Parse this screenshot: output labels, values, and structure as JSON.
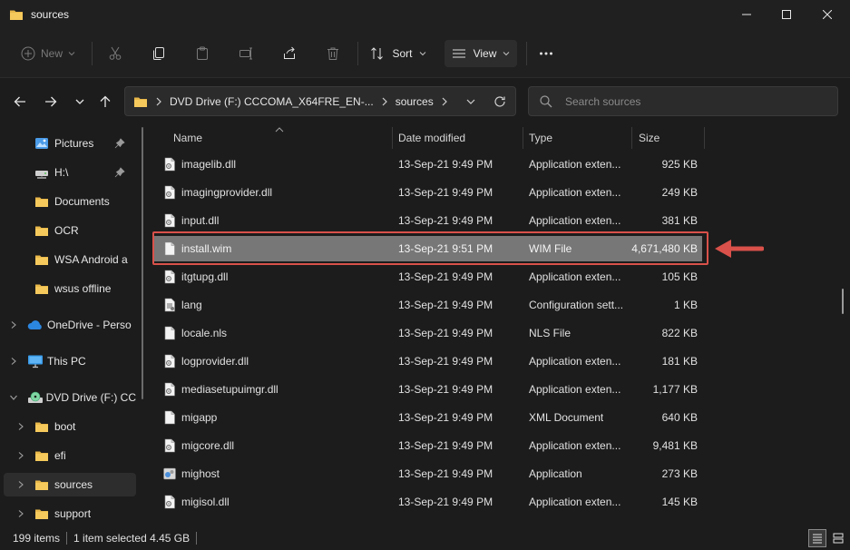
{
  "window": {
    "title": "sources",
    "controls": [
      "minimize-icon",
      "maximize-icon",
      "close-icon"
    ]
  },
  "toolbar": {
    "new_label": "New",
    "sort_label": "Sort",
    "view_label": "View",
    "icons": [
      "cut-icon",
      "copy-icon",
      "paste-icon",
      "rename-icon",
      "share-icon",
      "delete-icon",
      "more-icon"
    ]
  },
  "address": {
    "drive": "DVD Drive (F:) CCCOMA_X64FRE_EN-...",
    "folder": "sources",
    "search_placeholder": "Search sources"
  },
  "sidebar": {
    "items": [
      {
        "label": "Pictures",
        "icon": "pictures-icon",
        "pinned": true
      },
      {
        "label": "H:\\",
        "icon": "network-drive-icon",
        "pinned": true
      },
      {
        "label": "Documents",
        "icon": "folder-icon"
      },
      {
        "label": "OCR",
        "icon": "folder-icon"
      },
      {
        "label": "WSA Android a",
        "icon": "folder-icon"
      },
      {
        "label": "wsus offline",
        "icon": "folder-icon"
      },
      {
        "label": "OneDrive - Perso",
        "icon": "onedrive-icon"
      },
      {
        "label": "This PC",
        "icon": "computer-icon"
      },
      {
        "label": "DVD Drive (F:) CC",
        "icon": "dvd-drive-icon"
      },
      {
        "label": "boot",
        "icon": "folder-icon"
      },
      {
        "label": "efi",
        "icon": "folder-icon"
      },
      {
        "label": "sources",
        "icon": "folder-icon",
        "selected": true
      },
      {
        "label": "support",
        "icon": "folder-icon"
      }
    ]
  },
  "columns": {
    "name": "Name",
    "date": "Date modified",
    "type": "Type",
    "size": "Size"
  },
  "files": [
    {
      "name": "imagelib.dll",
      "date": "13-Sep-21 9:49 PM",
      "type": "Application exten...",
      "size": "925 KB",
      "icon": "dll-file-icon"
    },
    {
      "name": "imagingprovider.dll",
      "date": "13-Sep-21 9:49 PM",
      "type": "Application exten...",
      "size": "249 KB",
      "icon": "dll-file-icon"
    },
    {
      "name": "input.dll",
      "date": "13-Sep-21 9:49 PM",
      "type": "Application exten...",
      "size": "381 KB",
      "icon": "dll-file-icon"
    },
    {
      "name": "install.wim",
      "date": "13-Sep-21 9:51 PM",
      "type": "WIM File",
      "size": "4,671,480 KB",
      "icon": "file-icon",
      "selected": true
    },
    {
      "name": "itgtupg.dll",
      "date": "13-Sep-21 9:49 PM",
      "type": "Application exten...",
      "size": "105 KB",
      "icon": "dll-file-icon"
    },
    {
      "name": "lang",
      "date": "13-Sep-21 9:49 PM",
      "type": "Configuration sett...",
      "size": "1 KB",
      "icon": "config-file-icon"
    },
    {
      "name": "locale.nls",
      "date": "13-Sep-21 9:49 PM",
      "type": "NLS File",
      "size": "822 KB",
      "icon": "file-icon"
    },
    {
      "name": "logprovider.dll",
      "date": "13-Sep-21 9:49 PM",
      "type": "Application exten...",
      "size": "181 KB",
      "icon": "dll-file-icon"
    },
    {
      "name": "mediasetupuimgr.dll",
      "date": "13-Sep-21 9:49 PM",
      "type": "Application exten...",
      "size": "1,177 KB",
      "icon": "dll-file-icon"
    },
    {
      "name": "migapp",
      "date": "13-Sep-21 9:49 PM",
      "type": "XML Document",
      "size": "640 KB",
      "icon": "file-icon"
    },
    {
      "name": "migcore.dll",
      "date": "13-Sep-21 9:49 PM",
      "type": "Application exten...",
      "size": "9,481 KB",
      "icon": "dll-file-icon"
    },
    {
      "name": "mighost",
      "date": "13-Sep-21 9:49 PM",
      "type": "Application",
      "size": "273 KB",
      "icon": "application-icon"
    },
    {
      "name": "migisol.dll",
      "date": "13-Sep-21 9:49 PM",
      "type": "Application exten...",
      "size": "145 KB",
      "icon": "dll-file-icon"
    }
  ],
  "status": {
    "items": "199 items",
    "selected": "1 item selected  4.45 GB"
  },
  "colors": {
    "annotation": "#d9514a",
    "selection": "#777777",
    "folder": "#e8b84a"
  }
}
